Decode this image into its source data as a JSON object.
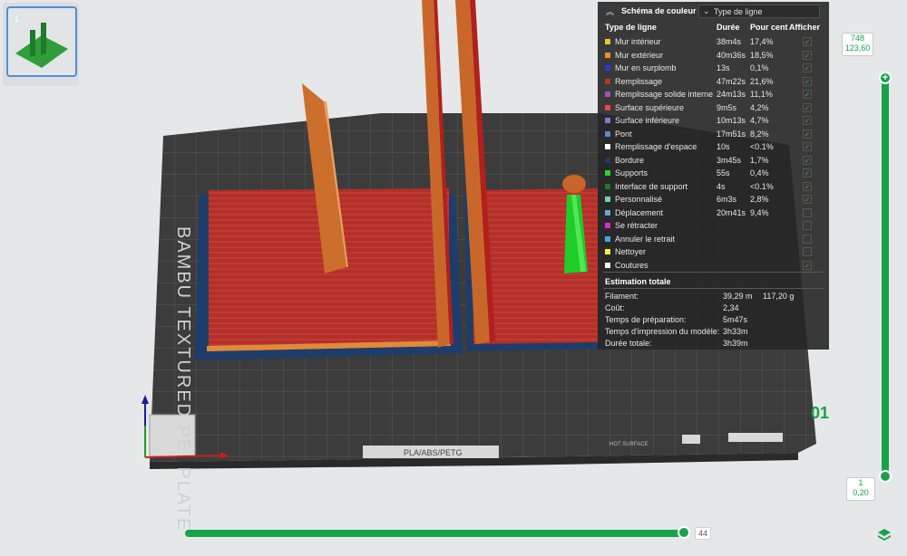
{
  "plate": {
    "number": "1"
  },
  "legend": {
    "title": "Schéma de couleur",
    "view_mode": "Type de ligne",
    "headers": {
      "type": "Type de ligne",
      "duration": "Durée",
      "percent": "Pour cent",
      "show": "Afficher"
    },
    "rows": [
      {
        "name": "Mur intérieur",
        "color": "#f2c230",
        "duration": "38m4s",
        "percent": "17,4%",
        "checked": true
      },
      {
        "name": "Mur extérieur",
        "color": "#f08a2a",
        "duration": "40m36s",
        "percent": "18,5%",
        "checked": true
      },
      {
        "name": "Mur en surplomb",
        "color": "#2a3bd4",
        "duration": "13s",
        "percent": "0,1%",
        "checked": true
      },
      {
        "name": "Remplissage",
        "color": "#b5352e",
        "duration": "47m22s",
        "percent": "21,6%",
        "checked": true
      },
      {
        "name": "Remplissage solide interne",
        "color": "#a24fc0",
        "duration": "24m13s",
        "percent": "11,1%",
        "checked": true
      },
      {
        "name": "Surface supérieure",
        "color": "#e8454a",
        "duration": "9m5s",
        "percent": "4,2%",
        "checked": true
      },
      {
        "name": "Surface inférieure",
        "color": "#8a72d8",
        "duration": "10m13s",
        "percent": "4,7%",
        "checked": true
      },
      {
        "name": "Pont",
        "color": "#5b8ac8",
        "duration": "17m51s",
        "percent": "8,2%",
        "checked": true
      },
      {
        "name": "Remplissage d'espace",
        "color": "#ffffff",
        "duration": "10s",
        "percent": "<0.1%",
        "checked": true
      },
      {
        "name": "Bordure",
        "color": "#1b3a66",
        "duration": "3m45s",
        "percent": "1,7%",
        "checked": true
      },
      {
        "name": "Supports",
        "color": "#22d62c",
        "duration": "55s",
        "percent": "0,4%",
        "checked": true
      },
      {
        "name": "Interface de support",
        "color": "#1d7a22",
        "duration": "4s",
        "percent": "<0.1%",
        "checked": true
      },
      {
        "name": "Personnalisé",
        "color": "#6fd6a2",
        "duration": "6m3s",
        "percent": "2,8%",
        "checked": true
      },
      {
        "name": "Déplacement",
        "color": "#6aa3d8",
        "duration": "20m41s",
        "percent": "9,4%",
        "checked": false
      },
      {
        "name": "Se rétracter",
        "color": "#d62ad0",
        "duration": "",
        "percent": "",
        "checked": false
      },
      {
        "name": "Annuler le retrait",
        "color": "#4aa8d8",
        "duration": "",
        "percent": "",
        "checked": false
      },
      {
        "name": "Nettoyer",
        "color": "#f5f13a",
        "duration": "",
        "percent": "",
        "checked": false
      },
      {
        "name": "Coutures",
        "color": "#f2f2f2",
        "duration": "",
        "percent": "",
        "checked": true
      }
    ],
    "estimation": {
      "title": "Estimation totale",
      "rows": [
        {
          "label": "Filament:",
          "value": "39,29 m",
          "value2": "117,20 g"
        },
        {
          "label": "Coût:",
          "value": "2,34",
          "value2": ""
        },
        {
          "label": "Temps de préparation:",
          "value": "5m47s",
          "value2": ""
        },
        {
          "label": "Temps d'impression du modèle:",
          "value": "3h33m",
          "value2": ""
        },
        {
          "label": "Durée totale:",
          "value": "3h39m",
          "value2": ""
        }
      ]
    }
  },
  "vertical_slider": {
    "top_layer": "748",
    "top_height": "123,60",
    "bottom_layer": "1",
    "bottom_height": "0,20",
    "plus_label": "+"
  },
  "horizontal_slider": {
    "value": "44",
    "fraction": 1.0
  },
  "plate_labels": {
    "brand_text": "BAMBU TEXTURED PEI PLATE",
    "plate_number": "01",
    "filament_text": "PLA/ABS/PETG",
    "surface_text": "HOT SURFACE"
  },
  "icons": {
    "legend_collapse": "chevron-up-icon",
    "view_dropdown": "chevron-down-icon",
    "layers": "layers-icon",
    "checkmark": "check-icon"
  },
  "colors": {
    "accent": "#16a34a",
    "panel": "#262626",
    "infill": "#b5352e",
    "wall": "#d8742f"
  }
}
